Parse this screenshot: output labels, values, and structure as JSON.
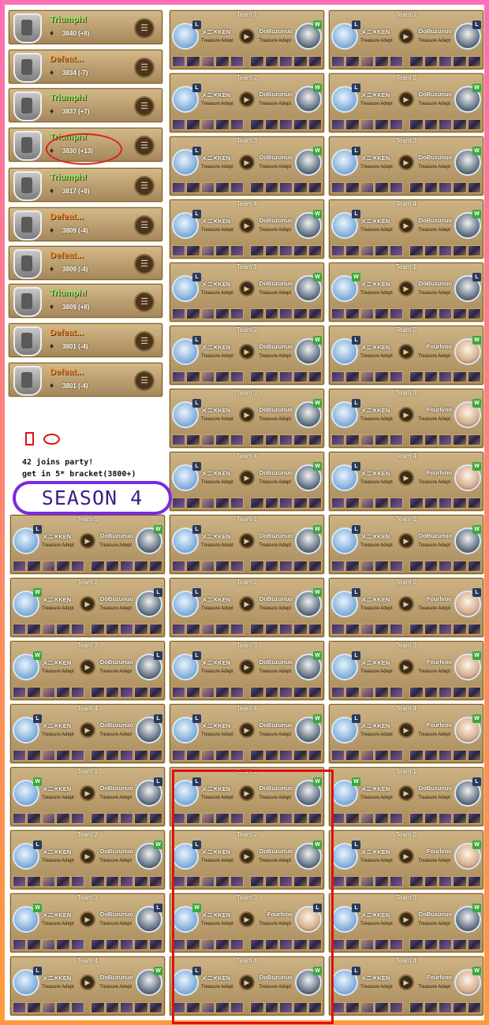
{
  "records": [
    {
      "result": "Triumph!",
      "type": "win",
      "score": "3840",
      "delta": "(+8)"
    },
    {
      "result": "Defeat...",
      "type": "loss",
      "score": "3834",
      "delta": "(-7)"
    },
    {
      "result": "Triumph!",
      "type": "win",
      "score": "3837",
      "delta": "(+7)"
    },
    {
      "result": "Triumph!",
      "type": "win",
      "score": "3830",
      "delta": "(+13)"
    },
    {
      "result": "Triumph!",
      "type": "win",
      "score": "3817",
      "delta": "(+8)"
    },
    {
      "result": "Defeat...",
      "type": "loss",
      "score": "3809",
      "delta": "(-4)"
    },
    {
      "result": "Defeat...",
      "type": "loss",
      "score": "3809",
      "delta": "(-4)"
    },
    {
      "result": "Triumph!",
      "type": "win",
      "score": "3809",
      "delta": "(+8)"
    },
    {
      "result": "Defeat...",
      "type": "loss",
      "score": "3801",
      "delta": "(-4)"
    },
    {
      "result": "Defeat...",
      "type": "loss",
      "score": "3801",
      "delta": "(-4)"
    }
  ],
  "notes": {
    "line1": "42 joins party!",
    "line2": "get in 5* bracket(3800+)",
    "season": "SEASON 4"
  },
  "player": {
    "name": "メニ✕KEN",
    "title": "Treasure Adept"
  },
  "opponents": {
    "a": "DoBuzunuo",
    "b": "Fourlvoo"
  },
  "icons": {
    "result_icon": "trophy-icon",
    "stats": "bar-chart-icon",
    "play": "play-icon",
    "gold": "gold-pouch-icon"
  },
  "colors": {
    "win": "#8ef26a",
    "loss": "#ff9a3a",
    "highlight": "#e01010",
    "season_border": "#7a2ae0"
  },
  "teams": [
    {
      "label": "Team 1",
      "opp": "a",
      "badge_l": "L",
      "badge_r": "W"
    },
    {
      "label": "Team 2",
      "opp": "a",
      "badge_l": "L",
      "badge_r": "W"
    },
    {
      "label": "Team 3",
      "opp": "a",
      "badge_l": "L",
      "badge_r": "W"
    },
    {
      "label": "Team 4",
      "opp": "a",
      "badge_l": "L",
      "badge_r": "W"
    },
    {
      "label": "Team 1",
      "opp": "a",
      "badge_l": "L",
      "badge_r": "W"
    },
    {
      "label": "Team 2",
      "opp": "a",
      "badge_l": "L",
      "badge_r": "W"
    },
    {
      "label": "Team 3",
      "opp": "a",
      "badge_l": "L",
      "badge_r": "W"
    },
    {
      "label": "Team 4",
      "opp": "a",
      "badge_l": "L",
      "badge_r": "W"
    },
    {
      "label": "Team 1",
      "opp": "a",
      "badge_l": "L",
      "badge_r": "L"
    },
    {
      "label": "Team 2",
      "opp": "a",
      "badge_l": "L",
      "badge_r": "W"
    },
    {
      "label": "Team 3",
      "opp": "a",
      "badge_l": "L",
      "badge_r": "W"
    },
    {
      "label": "Team 4",
      "opp": "a",
      "badge_l": "L",
      "badge_r": "W"
    },
    {
      "label": "Team 1",
      "opp": "a",
      "badge_l": "W",
      "badge_r": "L"
    },
    {
      "label": "Team 2",
      "opp": "b",
      "badge_l": "L",
      "badge_r": "W"
    },
    {
      "label": "Team 3",
      "opp": "b",
      "badge_l": "L",
      "badge_r": "W"
    },
    {
      "label": "Team 4",
      "opp": "b",
      "badge_l": "L",
      "badge_r": "W"
    },
    {
      "label": "Team 1",
      "opp": "a",
      "badge_l": "L",
      "badge_r": "W"
    },
    {
      "label": "Team 2",
      "opp": "a",
      "badge_l": "W",
      "badge_r": "L"
    },
    {
      "label": "Team 3",
      "opp": "a",
      "badge_l": "W",
      "badge_r": "L"
    },
    {
      "label": "Team 4",
      "opp": "a",
      "badge_l": "L",
      "badge_r": "L"
    },
    {
      "label": "Team 1",
      "opp": "a",
      "badge_l": "W",
      "badge_r": "L"
    },
    {
      "label": "Team 2",
      "opp": "a",
      "badge_l": "L",
      "badge_r": "W"
    },
    {
      "label": "Team 3",
      "opp": "a",
      "badge_l": "W",
      "badge_r": "L"
    },
    {
      "label": "Team 4",
      "opp": "a",
      "badge_l": "L",
      "badge_r": "W"
    },
    {
      "label": "Team 1",
      "opp": "a",
      "badge_l": "L",
      "badge_r": "W"
    },
    {
      "label": "Team 2",
      "opp": "a",
      "badge_l": "L",
      "badge_r": "W"
    },
    {
      "label": "Team 3",
      "opp": "a",
      "badge_l": "L",
      "badge_r": "W"
    },
    {
      "label": "Team 4",
      "opp": "a",
      "badge_l": "L",
      "badge_r": "W"
    },
    {
      "label": "Team 1",
      "opp": "a",
      "badge_l": "L",
      "badge_r": "W"
    },
    {
      "label": "Team 2",
      "opp": "a",
      "badge_l": "L",
      "badge_r": "W"
    },
    {
      "label": "Team 3",
      "opp": "b",
      "badge_l": "W",
      "badge_r": "L"
    },
    {
      "label": "Team 4",
      "opp": "a",
      "badge_l": "L",
      "badge_r": "W"
    },
    {
      "label": "Team 1",
      "opp": "a",
      "badge_l": "L",
      "badge_r": "W"
    },
    {
      "label": "Team 2",
      "opp": "b",
      "badge_l": "L",
      "badge_r": "L"
    },
    {
      "label": "Team 3",
      "opp": "b",
      "badge_l": "L",
      "badge_r": "W"
    },
    {
      "label": "Team 4",
      "opp": "b",
      "badge_l": "L",
      "badge_r": "W"
    },
    {
      "label": "Team 1",
      "opp": "a",
      "badge_l": "W",
      "badge_r": "L"
    },
    {
      "label": "Team 2",
      "opp": "b",
      "badge_l": "L",
      "badge_r": "W"
    },
    {
      "label": "Team 3",
      "opp": "a",
      "badge_l": "L",
      "badge_r": "W"
    },
    {
      "label": "Team 4",
      "opp": "b",
      "badge_l": "L",
      "badge_r": "W"
    }
  ]
}
